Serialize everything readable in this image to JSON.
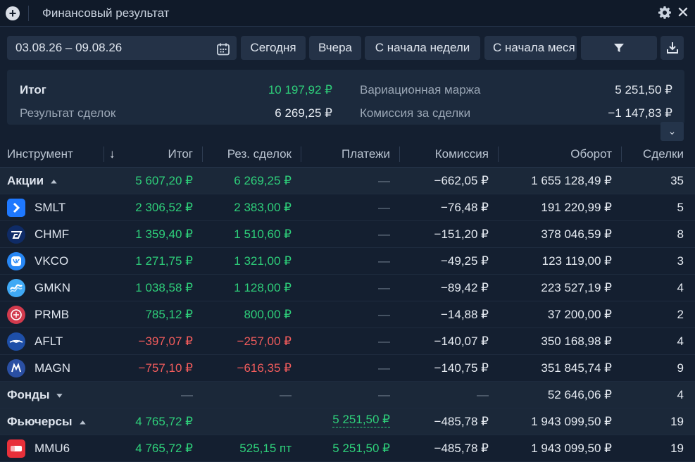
{
  "window": {
    "title": "Финансовый результат"
  },
  "toolbar": {
    "date_range": "03.08.26 – 09.08.26",
    "today": "Сегодня",
    "yesterday": "Вчера",
    "week_start": "С начала недели",
    "month_start": "С начала меся"
  },
  "summary": {
    "total_label": "Итог",
    "total_value": "10 197,92 ₽",
    "deals_label": "Результат сделок",
    "deals_value": "6 269,25 ₽",
    "margin_label": "Вариационная маржа",
    "margin_value": "5 251,50 ₽",
    "commission_label": "Комиссия за сделки",
    "commission_value": "−1 147,83 ₽"
  },
  "table": {
    "headers": {
      "instrument": "Инструмент",
      "total": "Итог",
      "deals": "Рез. сделок",
      "payments": "Платежи",
      "commission": "Комиссия",
      "turnover": "Оборот",
      "trades": "Сделки"
    },
    "rows": [
      {
        "kind": "group",
        "name": "Акции",
        "chev": "⌃",
        "total": "5 607,20 ₽",
        "deals": "6 269,25 ₽",
        "payments": "—",
        "commission": "−662,05 ₽",
        "turnover": "1 655 128,49 ₽",
        "trades": "35",
        "total_color": "green",
        "deals_color": "green"
      },
      {
        "kind": "item",
        "name": "SMLT",
        "logo": "smlt",
        "total": "2 306,52 ₽",
        "deals": "2 383,00 ₽",
        "payments": "—",
        "commission": "−76,48 ₽",
        "turnover": "191 220,99 ₽",
        "trades": "5",
        "total_color": "green",
        "deals_color": "green"
      },
      {
        "kind": "item",
        "name": "CHMF",
        "logo": "chmf",
        "total": "1 359,40 ₽",
        "deals": "1 510,60 ₽",
        "payments": "—",
        "commission": "−151,20 ₽",
        "turnover": "378 046,59 ₽",
        "trades": "8",
        "total_color": "green",
        "deals_color": "green"
      },
      {
        "kind": "item",
        "name": "VKCO",
        "logo": "vkco",
        "total": "1 271,75 ₽",
        "deals": "1 321,00 ₽",
        "payments": "—",
        "commission": "−49,25 ₽",
        "turnover": "123 119,00 ₽",
        "trades": "3",
        "total_color": "green",
        "deals_color": "green"
      },
      {
        "kind": "item",
        "name": "GMKN",
        "logo": "gmkn",
        "total": "1 038,58 ₽",
        "deals": "1 128,00 ₽",
        "payments": "—",
        "commission": "−89,42 ₽",
        "turnover": "223 527,19 ₽",
        "trades": "4",
        "total_color": "green",
        "deals_color": "green"
      },
      {
        "kind": "item",
        "name": "PRMB",
        "logo": "prmb",
        "total": "785,12 ₽",
        "deals": "800,00 ₽",
        "payments": "—",
        "commission": "−14,88 ₽",
        "turnover": "37 200,00 ₽",
        "trades": "2",
        "total_color": "green",
        "deals_color": "green"
      },
      {
        "kind": "item",
        "name": "AFLT",
        "logo": "aflt",
        "total": "−397,07 ₽",
        "deals": "−257,00 ₽",
        "payments": "—",
        "commission": "−140,07 ₽",
        "turnover": "350 168,98 ₽",
        "trades": "4",
        "total_color": "red",
        "deals_color": "red"
      },
      {
        "kind": "item",
        "name": "MAGN",
        "logo": "magn",
        "total": "−757,10 ₽",
        "deals": "−616,35 ₽",
        "payments": "—",
        "commission": "−140,75 ₽",
        "turnover": "351 845,74 ₽",
        "trades": "9",
        "total_color": "red",
        "deals_color": "red"
      },
      {
        "kind": "group",
        "name": "Фонды",
        "chev": "⌄",
        "total": "—",
        "deals": "—",
        "payments": "—",
        "commission": "—",
        "turnover": "52 646,06 ₽",
        "trades": "4",
        "total_color": "dash",
        "deals_color": "dash",
        "payments_color": "dash",
        "commission_color": "dash"
      },
      {
        "kind": "group",
        "name": "Фьючерсы",
        "chev": "⌃",
        "total": "4 765,72 ₽",
        "deals": "",
        "payments": "5 251,50 ₽",
        "commission": "−485,78 ₽",
        "turnover": "1 943 099,50 ₽",
        "trades": "19",
        "total_color": "green",
        "payments_color": "green",
        "payments_dotted": true
      },
      {
        "kind": "item",
        "name": "MMU6",
        "logo": "mmu6",
        "total": "4 765,72 ₽",
        "deals": "525,15 пт",
        "payments": "5 251,50 ₽",
        "commission": "−485,78 ₽",
        "turnover": "1 943 099,50 ₽",
        "trades": "19",
        "total_color": "green",
        "deals_color": "green",
        "payments_color": "green"
      }
    ]
  },
  "colors": {
    "positive": "#2ecf7a",
    "negative": "#f25c5c",
    "background": "#141f30",
    "panel": "#1c2a3d",
    "button": "#243247"
  },
  "icons": {
    "add": "plus-circle-icon",
    "settings": "gear-icon",
    "close": "close-icon",
    "calendar": "calendar-icon",
    "filter": "filter-icon",
    "download": "download-icon",
    "expand": "chevron-down-icon",
    "sort": "arrow-down-icon"
  }
}
